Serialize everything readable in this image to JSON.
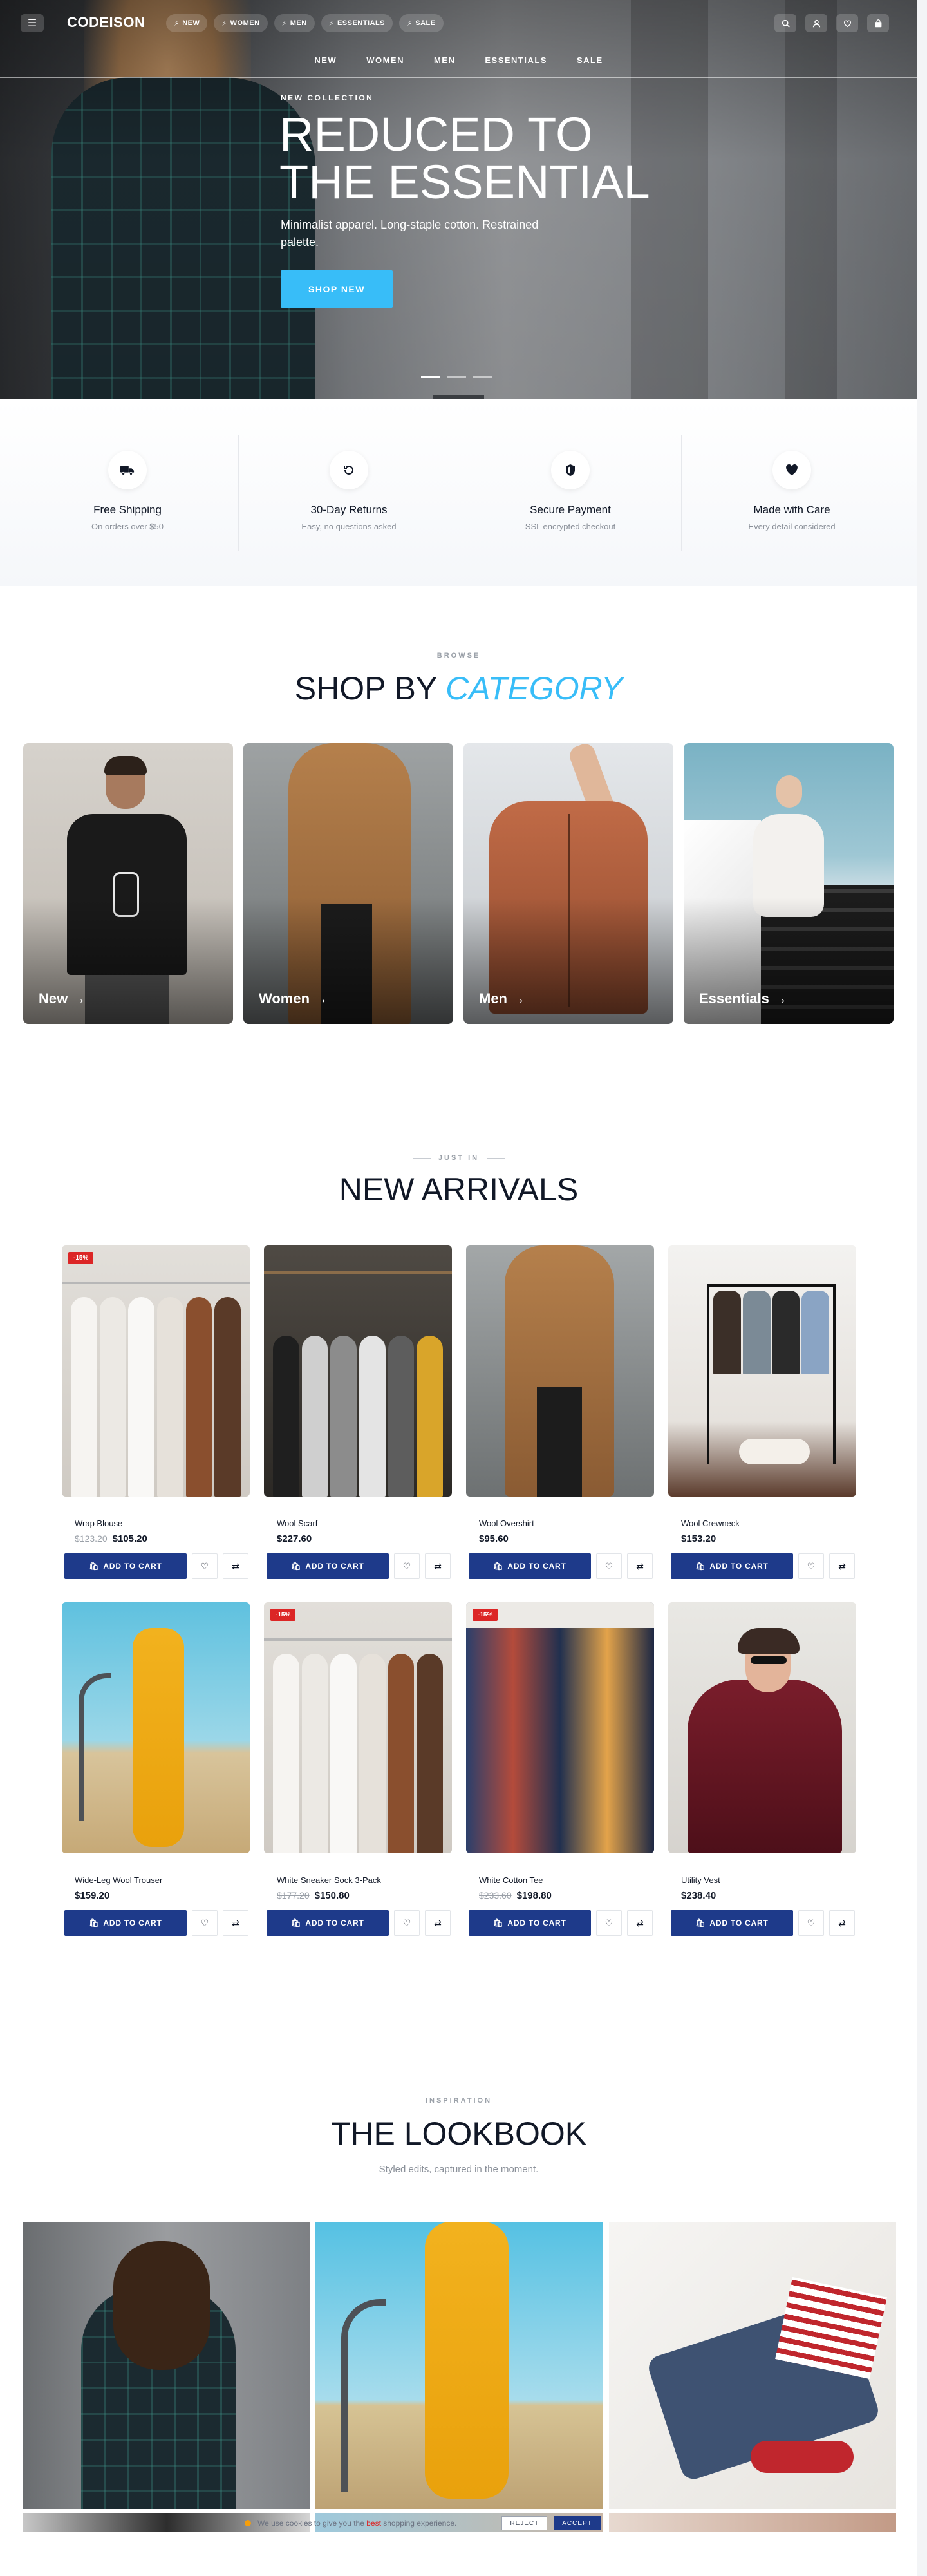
{
  "header": {
    "logo": "CODEISON",
    "pills": [
      "NEW",
      "WOMEN",
      "MEN",
      "ESSENTIALS",
      "SALE"
    ],
    "nav": [
      "NEW",
      "WOMEN",
      "MEN",
      "ESSENTIALS",
      "SALE"
    ],
    "icons": [
      "search-icon",
      "user-icon",
      "heart-icon",
      "bag-icon"
    ]
  },
  "hero": {
    "eyebrow": "NEW COLLECTION",
    "title_line1": "REDUCED TO",
    "title_line2": "THE ESSENTIAL",
    "subtitle": "Minimalist apparel. Long-staple cotton. Restrained palette.",
    "cta": "SHOP NEW",
    "slides": 3,
    "active_slide": 1
  },
  "features": [
    {
      "icon": "truck-icon",
      "title": "Free Shipping",
      "subtitle": "On orders over $50"
    },
    {
      "icon": "returns-icon",
      "title": "30-Day Returns",
      "subtitle": "Easy, no questions asked"
    },
    {
      "icon": "shield-icon",
      "title": "Secure Payment",
      "subtitle": "SSL encrypted checkout"
    },
    {
      "icon": "heart-icon",
      "title": "Made with Care",
      "subtitle": "Every detail considered"
    }
  ],
  "categories_section": {
    "kicker": "BROWSE",
    "title_plain": "SHOP BY",
    "title_accent": "CATEGORY",
    "items": [
      {
        "label": "New →"
      },
      {
        "label": "Women →"
      },
      {
        "label": "Men →"
      },
      {
        "label": "Essentials →"
      }
    ]
  },
  "arrivals_section": {
    "kicker": "JUST IN",
    "title": "NEW ARRIVALS",
    "add_to_cart": "ADD TO CART",
    "products": [
      {
        "name": "Wrap Blouse",
        "old_price": "$123.20",
        "price": "$105.20",
        "badge": "-15%"
      },
      {
        "name": "Wool Scarf",
        "old_price": "",
        "price": "$227.60",
        "badge": ""
      },
      {
        "name": "Wool Overshirt",
        "old_price": "",
        "price": "$95.60",
        "badge": ""
      },
      {
        "name": "Wool Crewneck",
        "old_price": "",
        "price": "$153.20",
        "badge": ""
      },
      {
        "name": "Wide-Leg Wool Trouser",
        "old_price": "",
        "price": "$159.20",
        "badge": ""
      },
      {
        "name": "White Sneaker Sock 3-Pack",
        "old_price": "$177.20",
        "price": "$150.80",
        "badge": "-15%"
      },
      {
        "name": "White Cotton Tee",
        "old_price": "$233.60",
        "price": "$198.80",
        "badge": "-15%"
      },
      {
        "name": "Utility Vest",
        "old_price": "",
        "price": "$238.40",
        "badge": ""
      }
    ]
  },
  "lookbook_section": {
    "kicker": "INSPIRATION",
    "title": "THE LOOKBOOK",
    "subtitle": "Styled edits, captured in the moment."
  },
  "cookie": {
    "text_before": "We use cookies to give you the",
    "text_highlight": "best",
    "text_after": "shopping experience.",
    "reject": "REJECT",
    "accept": "ACCEPT"
  },
  "colors": {
    "accent": "#38bdf8",
    "primary_button": "#1e3a8a",
    "sale_badge": "#dc2626"
  }
}
